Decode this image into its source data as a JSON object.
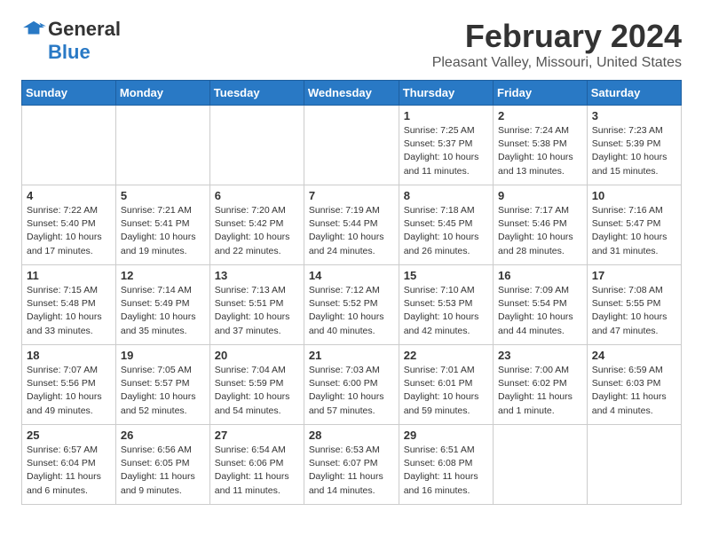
{
  "logo": {
    "general": "General",
    "blue": "Blue"
  },
  "title": "February 2024",
  "subtitle": "Pleasant Valley, Missouri, United States",
  "days_of_week": [
    "Sunday",
    "Monday",
    "Tuesday",
    "Wednesday",
    "Thursday",
    "Friday",
    "Saturday"
  ],
  "weeks": [
    [
      {
        "day": "",
        "info": ""
      },
      {
        "day": "",
        "info": ""
      },
      {
        "day": "",
        "info": ""
      },
      {
        "day": "",
        "info": ""
      },
      {
        "day": "1",
        "info": "Sunrise: 7:25 AM\nSunset: 5:37 PM\nDaylight: 10 hours\nand 11 minutes."
      },
      {
        "day": "2",
        "info": "Sunrise: 7:24 AM\nSunset: 5:38 PM\nDaylight: 10 hours\nand 13 minutes."
      },
      {
        "day": "3",
        "info": "Sunrise: 7:23 AM\nSunset: 5:39 PM\nDaylight: 10 hours\nand 15 minutes."
      }
    ],
    [
      {
        "day": "4",
        "info": "Sunrise: 7:22 AM\nSunset: 5:40 PM\nDaylight: 10 hours\nand 17 minutes."
      },
      {
        "day": "5",
        "info": "Sunrise: 7:21 AM\nSunset: 5:41 PM\nDaylight: 10 hours\nand 19 minutes."
      },
      {
        "day": "6",
        "info": "Sunrise: 7:20 AM\nSunset: 5:42 PM\nDaylight: 10 hours\nand 22 minutes."
      },
      {
        "day": "7",
        "info": "Sunrise: 7:19 AM\nSunset: 5:44 PM\nDaylight: 10 hours\nand 24 minutes."
      },
      {
        "day": "8",
        "info": "Sunrise: 7:18 AM\nSunset: 5:45 PM\nDaylight: 10 hours\nand 26 minutes."
      },
      {
        "day": "9",
        "info": "Sunrise: 7:17 AM\nSunset: 5:46 PM\nDaylight: 10 hours\nand 28 minutes."
      },
      {
        "day": "10",
        "info": "Sunrise: 7:16 AM\nSunset: 5:47 PM\nDaylight: 10 hours\nand 31 minutes."
      }
    ],
    [
      {
        "day": "11",
        "info": "Sunrise: 7:15 AM\nSunset: 5:48 PM\nDaylight: 10 hours\nand 33 minutes."
      },
      {
        "day": "12",
        "info": "Sunrise: 7:14 AM\nSunset: 5:49 PM\nDaylight: 10 hours\nand 35 minutes."
      },
      {
        "day": "13",
        "info": "Sunrise: 7:13 AM\nSunset: 5:51 PM\nDaylight: 10 hours\nand 37 minutes."
      },
      {
        "day": "14",
        "info": "Sunrise: 7:12 AM\nSunset: 5:52 PM\nDaylight: 10 hours\nand 40 minutes."
      },
      {
        "day": "15",
        "info": "Sunrise: 7:10 AM\nSunset: 5:53 PM\nDaylight: 10 hours\nand 42 minutes."
      },
      {
        "day": "16",
        "info": "Sunrise: 7:09 AM\nSunset: 5:54 PM\nDaylight: 10 hours\nand 44 minutes."
      },
      {
        "day": "17",
        "info": "Sunrise: 7:08 AM\nSunset: 5:55 PM\nDaylight: 10 hours\nand 47 minutes."
      }
    ],
    [
      {
        "day": "18",
        "info": "Sunrise: 7:07 AM\nSunset: 5:56 PM\nDaylight: 10 hours\nand 49 minutes."
      },
      {
        "day": "19",
        "info": "Sunrise: 7:05 AM\nSunset: 5:57 PM\nDaylight: 10 hours\nand 52 minutes."
      },
      {
        "day": "20",
        "info": "Sunrise: 7:04 AM\nSunset: 5:59 PM\nDaylight: 10 hours\nand 54 minutes."
      },
      {
        "day": "21",
        "info": "Sunrise: 7:03 AM\nSunset: 6:00 PM\nDaylight: 10 hours\nand 57 minutes."
      },
      {
        "day": "22",
        "info": "Sunrise: 7:01 AM\nSunset: 6:01 PM\nDaylight: 10 hours\nand 59 minutes."
      },
      {
        "day": "23",
        "info": "Sunrise: 7:00 AM\nSunset: 6:02 PM\nDaylight: 11 hours\nand 1 minute."
      },
      {
        "day": "24",
        "info": "Sunrise: 6:59 AM\nSunset: 6:03 PM\nDaylight: 11 hours\nand 4 minutes."
      }
    ],
    [
      {
        "day": "25",
        "info": "Sunrise: 6:57 AM\nSunset: 6:04 PM\nDaylight: 11 hours\nand 6 minutes."
      },
      {
        "day": "26",
        "info": "Sunrise: 6:56 AM\nSunset: 6:05 PM\nDaylight: 11 hours\nand 9 minutes."
      },
      {
        "day": "27",
        "info": "Sunrise: 6:54 AM\nSunset: 6:06 PM\nDaylight: 11 hours\nand 11 minutes."
      },
      {
        "day": "28",
        "info": "Sunrise: 6:53 AM\nSunset: 6:07 PM\nDaylight: 11 hours\nand 14 minutes."
      },
      {
        "day": "29",
        "info": "Sunrise: 6:51 AM\nSunset: 6:08 PM\nDaylight: 11 hours\nand 16 minutes."
      },
      {
        "day": "",
        "info": ""
      },
      {
        "day": "",
        "info": ""
      }
    ]
  ]
}
